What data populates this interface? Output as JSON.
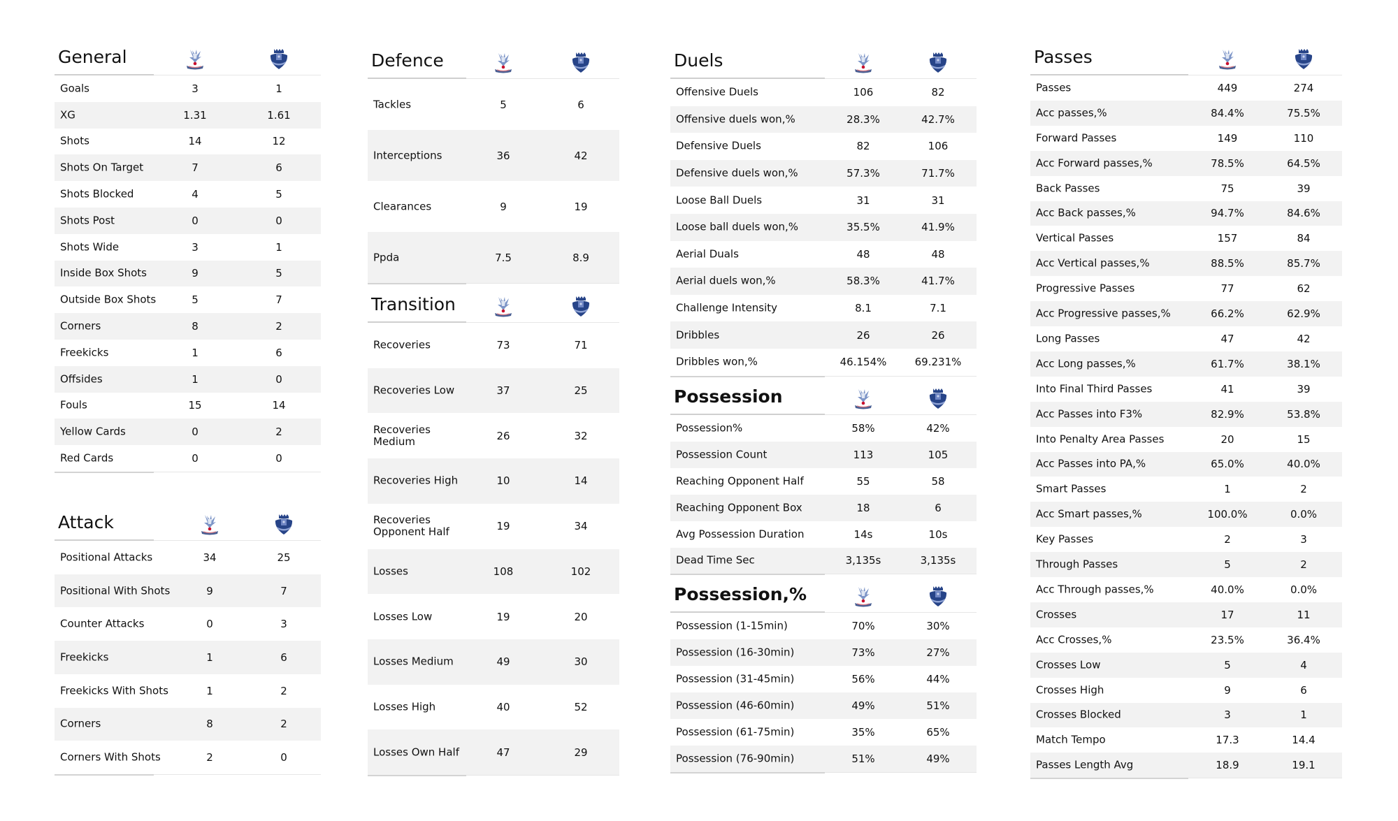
{
  "teams": [
    {
      "name": "Crystal Palace",
      "logo": "crystal-palace-crest-icon",
      "color": "#1b458f"
    },
    {
      "name": "Everton",
      "logo": "everton-crest-icon",
      "color": "#274488"
    }
  ],
  "sections": {
    "general": {
      "title": "General",
      "rows": [
        {
          "label": "Goals",
          "home": "3",
          "away": "1"
        },
        {
          "label": "XG",
          "home": "1.31",
          "away": "1.61"
        },
        {
          "label": "Shots",
          "home": "14",
          "away": "12"
        },
        {
          "label": "Shots On Target",
          "home": "7",
          "away": "6"
        },
        {
          "label": "Shots Blocked",
          "home": "4",
          "away": "5"
        },
        {
          "label": "Shots Post",
          "home": "0",
          "away": "0"
        },
        {
          "label": "Shots Wide",
          "home": "3",
          "away": "1"
        },
        {
          "label": "Inside Box Shots",
          "home": "9",
          "away": "5"
        },
        {
          "label": "Outside Box Shots",
          "home": "5",
          "away": "7"
        },
        {
          "label": "Corners",
          "home": "8",
          "away": "2"
        },
        {
          "label": "Freekicks",
          "home": "1",
          "away": "6"
        },
        {
          "label": "Offsides",
          "home": "1",
          "away": "0"
        },
        {
          "label": "Fouls",
          "home": "15",
          "away": "14"
        },
        {
          "label": "Yellow Cards",
          "home": "0",
          "away": "2"
        },
        {
          "label": "Red Cards",
          "home": "0",
          "away": "0"
        }
      ]
    },
    "attack": {
      "title": "Attack",
      "rows": [
        {
          "label": "Positional Attacks",
          "home": "34",
          "away": "25"
        },
        {
          "label": "Positional With Shots",
          "home": "9",
          "away": "7"
        },
        {
          "label": "Counter Attacks",
          "home": "0",
          "away": "3"
        },
        {
          "label": "Freekicks",
          "home": "1",
          "away": "6"
        },
        {
          "label": "Freekicks With Shots",
          "home": "1",
          "away": "2"
        },
        {
          "label": "Corners",
          "home": "8",
          "away": "2"
        },
        {
          "label": "Corners With Shots",
          "home": "2",
          "away": "0"
        }
      ]
    },
    "defence": {
      "title": "Defence",
      "rows": [
        {
          "label": "Tackles",
          "home": "5",
          "away": "6"
        },
        {
          "label": "Interceptions",
          "home": "36",
          "away": "42"
        },
        {
          "label": "Clearances",
          "home": "9",
          "away": "19"
        },
        {
          "label": "Ppda",
          "home": "7.5",
          "away": "8.9"
        }
      ]
    },
    "transition": {
      "title": "Transition",
      "rows": [
        {
          "label": "Recoveries",
          "home": "73",
          "away": "71"
        },
        {
          "label": "Recoveries Low",
          "home": "37",
          "away": "25"
        },
        {
          "label": "Recoveries Medium",
          "home": "26",
          "away": "32"
        },
        {
          "label": "Recoveries High",
          "home": "10",
          "away": "14"
        },
        {
          "label": "Recoveries Opponent Half",
          "home": "19",
          "away": "34"
        },
        {
          "label": "Losses",
          "home": "108",
          "away": "102"
        },
        {
          "label": "Losses Low",
          "home": "19",
          "away": "20"
        },
        {
          "label": "Losses Medium",
          "home": "49",
          "away": "30"
        },
        {
          "label": "Losses High",
          "home": "40",
          "away": "52"
        },
        {
          "label": "Losses Own Half",
          "home": "47",
          "away": "29"
        }
      ]
    },
    "duels": {
      "title": "Duels",
      "rows": [
        {
          "label": "Offensive Duels",
          "home": "106",
          "away": "82"
        },
        {
          "label": "Offensive duels won,%",
          "home": "28.3%",
          "away": "42.7%"
        },
        {
          "label": "Defensive Duels",
          "home": "82",
          "away": "106"
        },
        {
          "label": "Defensive duels won,%",
          "home": "57.3%",
          "away": "71.7%"
        },
        {
          "label": "Loose Ball Duels",
          "home": "31",
          "away": "31"
        },
        {
          "label": "Loose ball duels won,%",
          "home": "35.5%",
          "away": "41.9%"
        },
        {
          "label": "Aerial Duals",
          "home": "48",
          "away": "48"
        },
        {
          "label": "Aerial duels won,%",
          "home": "58.3%",
          "away": "41.7%"
        },
        {
          "label": "Challenge Intensity",
          "home": "8.1",
          "away": "7.1"
        },
        {
          "label": "Dribbles",
          "home": "26",
          "away": "26"
        },
        {
          "label": "Dribbles won,%",
          "home": "46.154%",
          "away": "69.231%"
        }
      ]
    },
    "possession": {
      "title": "Possession",
      "rows": [
        {
          "label": "Possession%",
          "home": "58%",
          "away": "42%"
        },
        {
          "label": "Possession Count",
          "home": "113",
          "away": "105"
        },
        {
          "label": "Reaching Opponent Half",
          "home": "55",
          "away": "58"
        },
        {
          "label": "Reaching Opponent Box",
          "home": "18",
          "away": "6"
        },
        {
          "label": "Avg Possession Duration",
          "home": "14s",
          "away": "10s"
        },
        {
          "label": "Dead Time Sec",
          "home": "3,135s",
          "away": "3,135s"
        }
      ]
    },
    "possession_pct": {
      "title": "Possession,%",
      "rows": [
        {
          "label": "Possession (1-15min)",
          "home": "70%",
          "away": "30%"
        },
        {
          "label": "Possession (16-30min)",
          "home": "73%",
          "away": "27%"
        },
        {
          "label": "Possession (31-45min)",
          "home": "56%",
          "away": "44%"
        },
        {
          "label": "Possession (46-60min)",
          "home": "49%",
          "away": "51%"
        },
        {
          "label": "Possession (61-75min)",
          "home": "35%",
          "away": "65%"
        },
        {
          "label": "Possession (76-90min)",
          "home": "51%",
          "away": "49%"
        }
      ]
    },
    "passes": {
      "title": "Passes",
      "rows": [
        {
          "label": "Passes",
          "home": "449",
          "away": "274"
        },
        {
          "label": "Acc passes,%",
          "home": "84.4%",
          "away": "75.5%"
        },
        {
          "label": "Forward Passes",
          "home": "149",
          "away": "110"
        },
        {
          "label": "Acc Forward passes,%",
          "home": "78.5%",
          "away": "64.5%"
        },
        {
          "label": "Back Passes",
          "home": "75",
          "away": "39"
        },
        {
          "label": "Acc Back passes,%",
          "home": "94.7%",
          "away": "84.6%"
        },
        {
          "label": "Vertical Passes",
          "home": "157",
          "away": "84"
        },
        {
          "label": "Acc Vertical passes,%",
          "home": "88.5%",
          "away": "85.7%"
        },
        {
          "label": "Progressive Passes",
          "home": "77",
          "away": "62"
        },
        {
          "label": "Acc Progressive passes,%",
          "home": "66.2%",
          "away": "62.9%"
        },
        {
          "label": "Long Passes",
          "home": "47",
          "away": "42"
        },
        {
          "label": "Acc Long passes,%",
          "home": "61.7%",
          "away": "38.1%"
        },
        {
          "label": "Into Final Third Passes",
          "home": "41",
          "away": "39"
        },
        {
          "label": "Acc Passes into F3%",
          "home": "82.9%",
          "away": "53.8%"
        },
        {
          "label": "Into Penalty Area Passes",
          "home": "20",
          "away": "15"
        },
        {
          "label": "Acc Passes into PA,%",
          "home": "65.0%",
          "away": "40.0%"
        },
        {
          "label": "Smart Passes",
          "home": "1",
          "away": "2"
        },
        {
          "label": "Acc Smart passes,%",
          "home": "100.0%",
          "away": "0.0%"
        },
        {
          "label": "Key Passes",
          "home": "2",
          "away": "3"
        },
        {
          "label": "Through Passes",
          "home": "5",
          "away": "2"
        },
        {
          "label": "Acc Through passes,%",
          "home": "40.0%",
          "away": "0.0%"
        },
        {
          "label": "Crosses",
          "home": "17",
          "away": "11"
        },
        {
          "label": "Acc Crosses,%",
          "home": "23.5%",
          "away": "36.4%"
        },
        {
          "label": "Crosses Low",
          "home": "5",
          "away": "4"
        },
        {
          "label": "Crosses High",
          "home": "9",
          "away": "6"
        },
        {
          "label": "Crosses Blocked",
          "home": "3",
          "away": "1"
        },
        {
          "label": "Match Tempo",
          "home": "17.3",
          "away": "14.4"
        },
        {
          "label": "Passes Length Avg",
          "home": "18.9",
          "away": "19.1"
        }
      ]
    }
  }
}
